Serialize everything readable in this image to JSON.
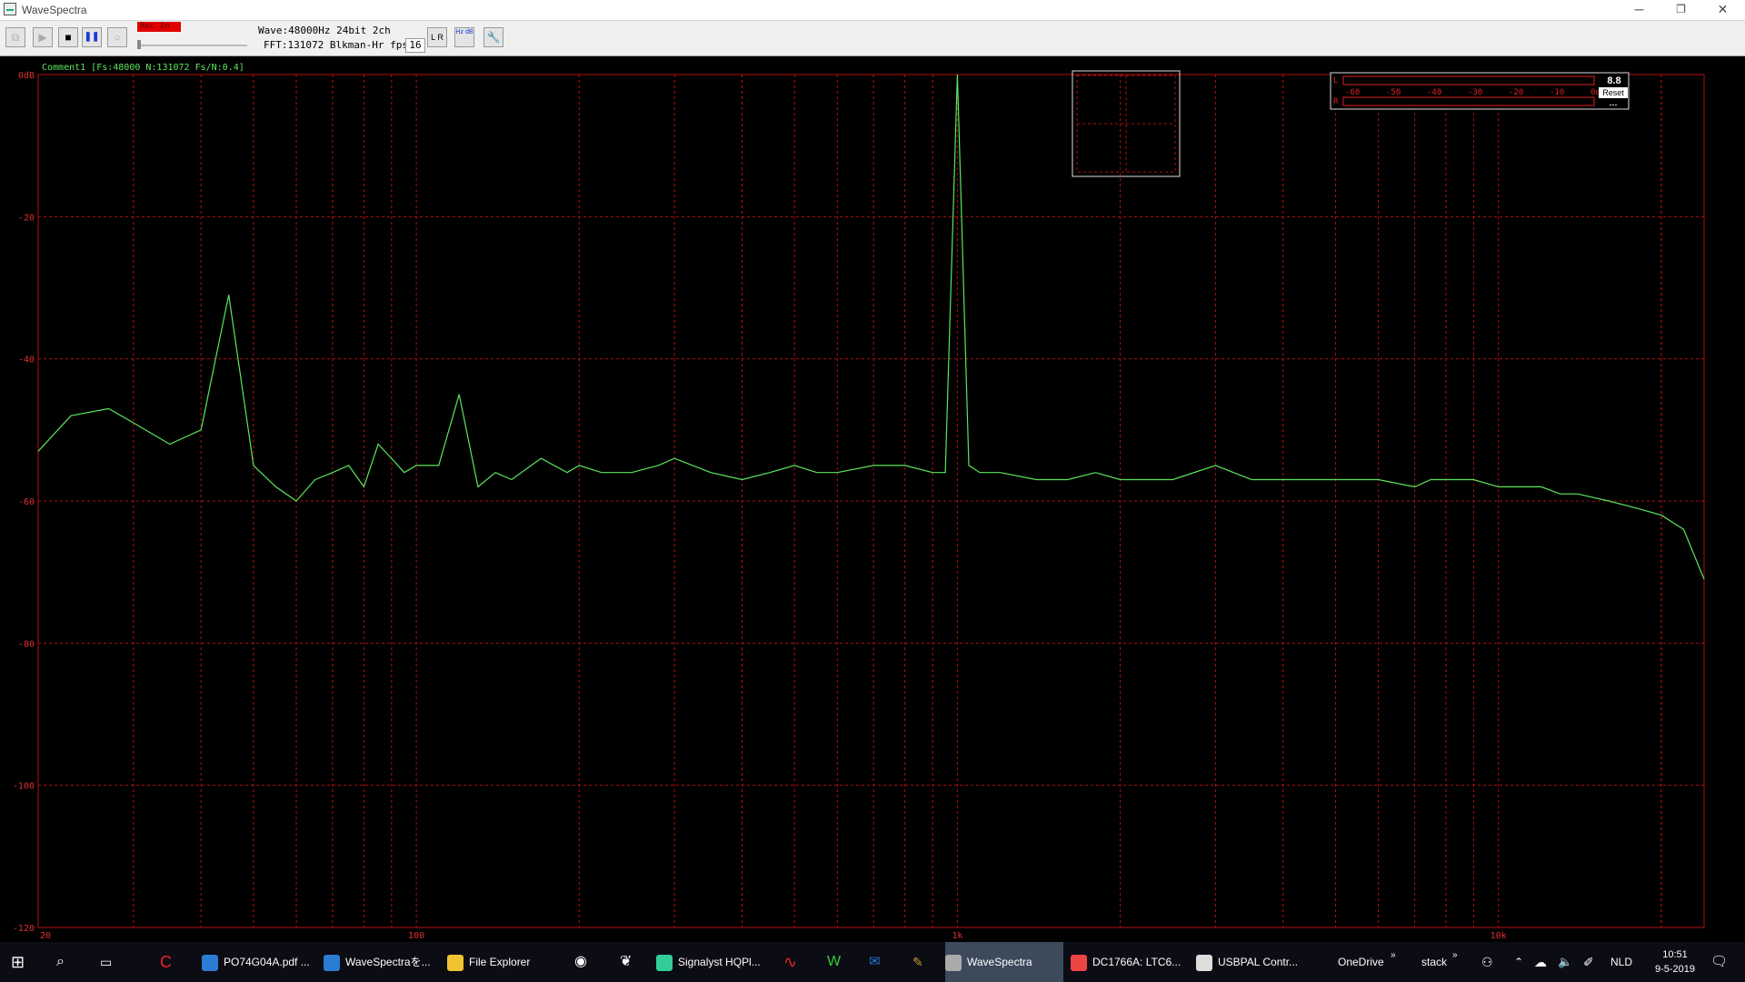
{
  "window": {
    "title": "WaveSpectra",
    "minimize": "─",
    "restore": "❐",
    "close": "✕"
  },
  "toolbar": {
    "rec_label": "Rec In",
    "wave_info": "Wave:48000Hz 24bit 2ch",
    "fft_info": "FFT:131072 Blkman-Hr fps:",
    "fps": "16",
    "btn_play": "▶",
    "btn_stop": "■",
    "btn_pause": "❚❚",
    "btn_loop": "○",
    "btn_lr": "L R",
    "btn_hz_db": "Hz dB",
    "btn_settings": "🔧"
  },
  "plot": {
    "comment": "Comment1  [Fs:48000 N:131072 Fs/N:0.4]",
    "y_ticks": [
      "0dB",
      "-20",
      "-40",
      "-60",
      "-80",
      "-100",
      "-120"
    ],
    "x_ticks": [
      "20",
      "100",
      "1k",
      "10k"
    ],
    "trace_color": "#5ce65c",
    "grid_color": "#b01010"
  },
  "meter": {
    "l": "L",
    "r": "R",
    "scale": [
      "-60",
      "-50",
      "-40",
      "-30",
      "-20",
      "-10",
      "0dB"
    ],
    "peak_value": "8.8",
    "reset": "Reset",
    "dash": "---"
  },
  "chart_data": {
    "type": "line",
    "title": "",
    "xlabel": "",
    "ylabel": "",
    "x_scale": "log",
    "xlim": [
      20,
      24000
    ],
    "ylim": [
      -120,
      0
    ],
    "grid": true,
    "series": [
      {
        "x": [
          20,
          23,
          27,
          30,
          35,
          40,
          45,
          50,
          55,
          60,
          65,
          70,
          75,
          80,
          85,
          90,
          95,
          100,
          110,
          120,
          130,
          140,
          150,
          170,
          190,
          200,
          220,
          250,
          280,
          300,
          350,
          400,
          450,
          500,
          550,
          600,
          700,
          800,
          900,
          950,
          1000,
          1050,
          1100,
          1200,
          1400,
          1600,
          1800,
          2000,
          2500,
          3000,
          3500,
          4000,
          4500,
          5000,
          6000,
          7000,
          7500,
          8000,
          9000,
          10000,
          11000,
          12000,
          13000,
          14000,
          16000,
          18000,
          20000,
          22000,
          24000
        ],
        "y": [
          -53,
          -48,
          -47,
          -49,
          -52,
          -50,
          -31,
          -55,
          -58,
          -60,
          -57,
          -56,
          -55,
          -58,
          -52,
          -54,
          -56,
          -55,
          -55,
          -45,
          -58,
          -56,
          -57,
          -54,
          -56,
          -55,
          -56,
          -56,
          -55,
          -54,
          -56,
          -57,
          -56,
          -55,
          -56,
          -56,
          -55,
          -55,
          -56,
          -56,
          0,
          -55,
          -56,
          -56,
          -57,
          -57,
          -56,
          -57,
          -57,
          -55,
          -57,
          -57,
          -57,
          -57,
          -57,
          -58,
          -57,
          -57,
          -57,
          -58,
          -58,
          -58,
          -59,
          -59,
          -60,
          -61,
          -62,
          -64,
          -71
        ]
      }
    ]
  },
  "taskbar": {
    "items": [
      {
        "label": "PO74G04A.pdf ...",
        "icon": "edge-icon",
        "color": "#2b7cd3"
      },
      {
        "label": "WaveSpectraを...",
        "icon": "edge-icon",
        "color": "#2b7cd3"
      },
      {
        "label": "File Explorer",
        "icon": "folder-icon",
        "color": "#f1c232"
      },
      {
        "label": "Signalyst HQPl...",
        "icon": "hqplayer-icon",
        "color": "#3c9"
      },
      {
        "label": "WaveSpectra",
        "icon": "wavespectra-icon",
        "color": "#aaa"
      },
      {
        "label": "DC1766A: LTC6...",
        "icon": "chrome-icon",
        "color": "#e44"
      },
      {
        "label": "USBPAL Contr...",
        "icon": "usbpal-icon",
        "color": "#ddd"
      }
    ],
    "onedrive": "OneDrive",
    "stack": "stack",
    "lang": "NLD",
    "time": "10:51",
    "date": "9-5-2019"
  }
}
